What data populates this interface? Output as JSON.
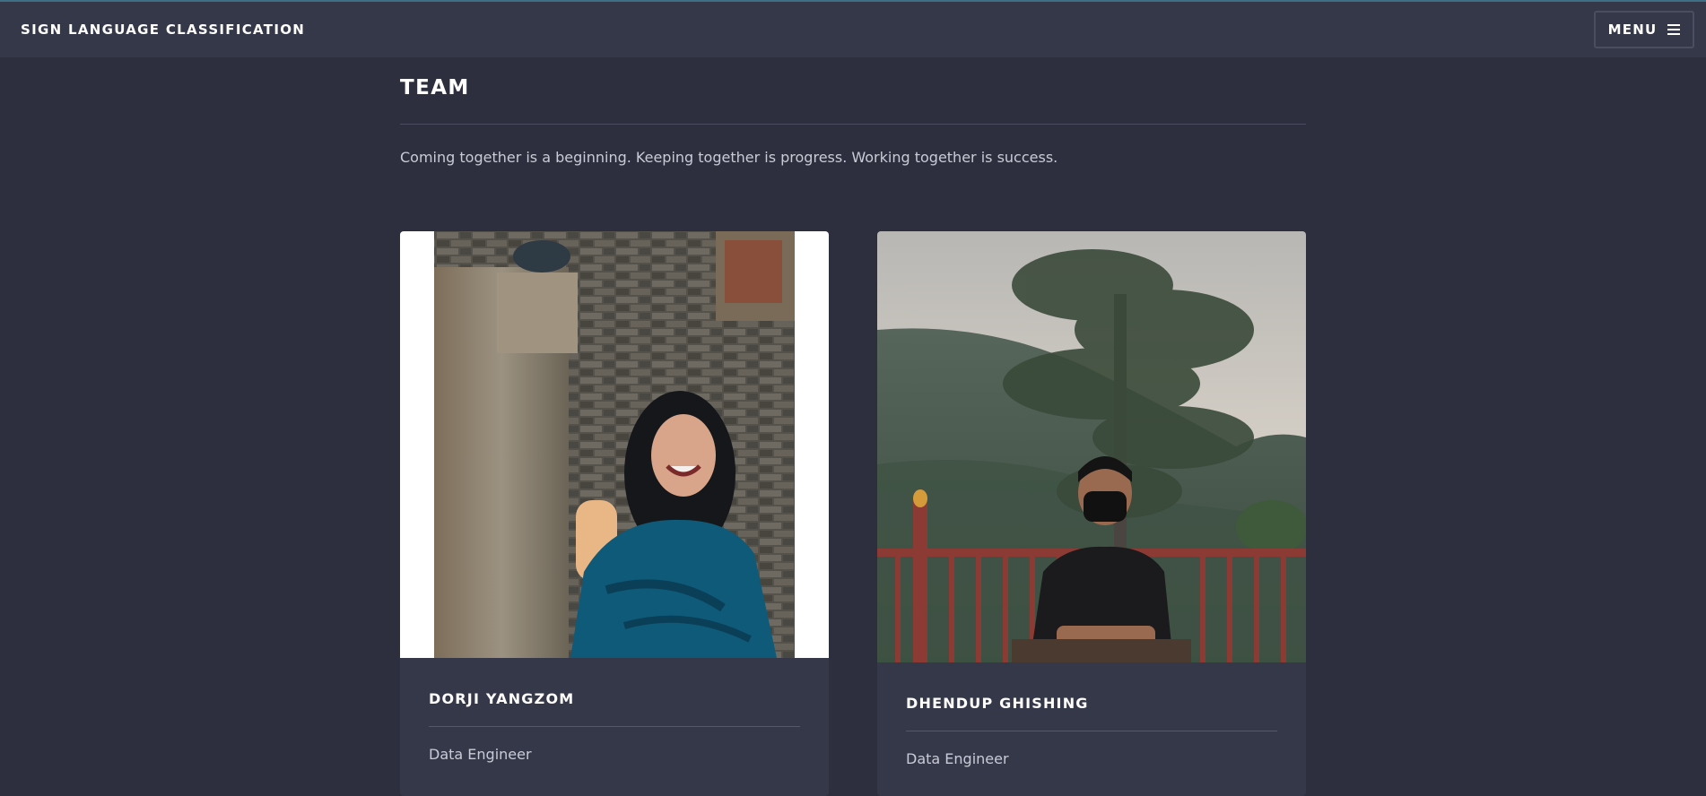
{
  "header": {
    "site_title": "SIGN LANGUAGE CLASSIFICATION",
    "menu_label": "MENU",
    "menu_icon": "hamburger-icon"
  },
  "section": {
    "title": "TEAM",
    "tagline": "Coming together is a beginning. Keeping together is progress. Working together is success."
  },
  "team": [
    {
      "name": "DORJI YANGZOM",
      "role": "Data Engineer",
      "photo": "team-member-photo"
    },
    {
      "name": "DHENDUP GHISHING",
      "role": "Data Engineer",
      "photo": "team-member-photo"
    }
  ],
  "colors": {
    "page_background": "#2d2f3e",
    "header_background": "#353849",
    "card_background": "#353849",
    "text_primary": "#ffffff",
    "text_secondary": "#c9cbd6"
  }
}
